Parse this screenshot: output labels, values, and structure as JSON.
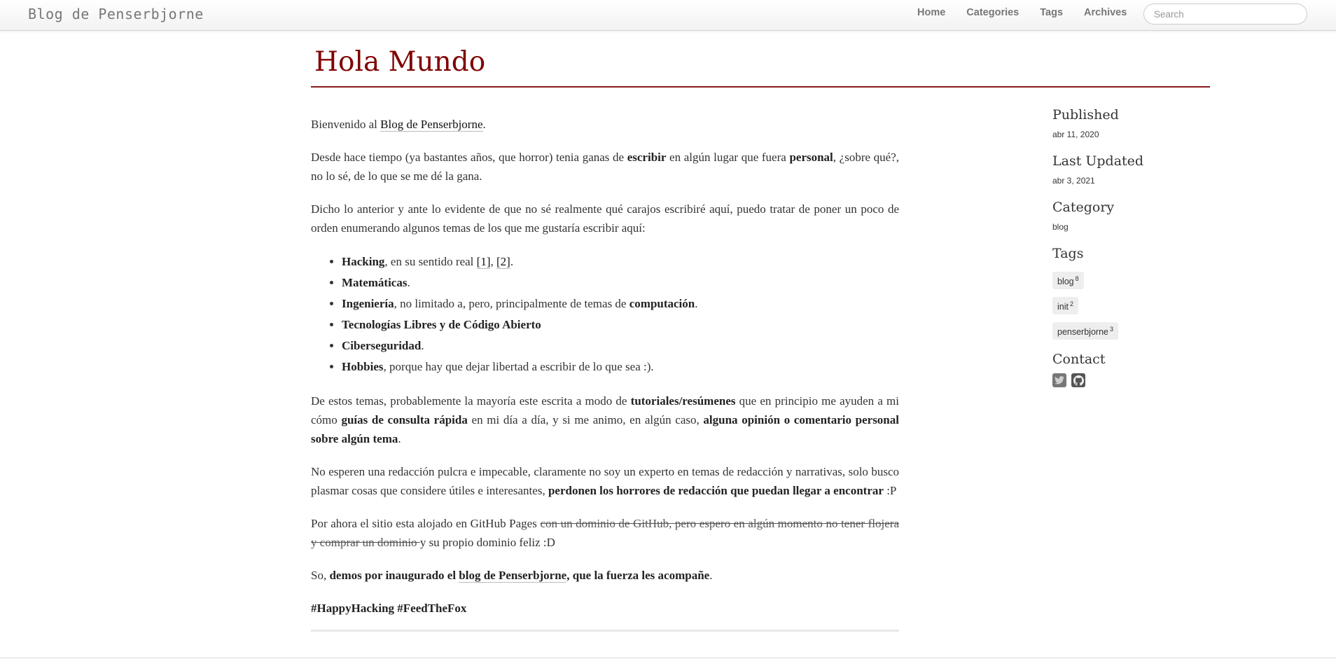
{
  "navbar": {
    "brand": "Blog de Penserbjorne",
    "links": [
      {
        "label": "Home"
      },
      {
        "label": "Categories"
      },
      {
        "label": "Tags"
      },
      {
        "label": "Archives"
      }
    ],
    "search_placeholder": "Search"
  },
  "post": {
    "title": "Hola Mundo",
    "p1": {
      "t1": "Bienvenido al ",
      "link": "Blog de Penserbjorne",
      "t2": "."
    },
    "p2": {
      "t1": "Desde hace tiempo (ya bastantes años, que horror) tenia ganas de ",
      "b1": "escribir",
      "t2": " en algún lugar que fuera ",
      "b2": "personal",
      "t3": ", ¿sobre qué?, no lo sé, de lo que se me dé la gana."
    },
    "p3": "Dicho lo anterior y ante lo evidente de que no sé realmente qué carajos escribiré aquí, puedo tratar de poner un poco de orden enumerando algunos temas de los que me gustaría escribir aquí:",
    "list": {
      "i1_b": "Hacking",
      "i1_t": ", en su sentido real ",
      "i1_ref1": "[1]",
      "i1_sep": ", ",
      "i1_ref2": "[2]",
      "i1_end": ".",
      "i2_b": "Matemáticas",
      "i2_t": ".",
      "i3_b1": "Ingeniería",
      "i3_t": ", no limitado a, pero, principalmente de temas de ",
      "i3_b2": "computación",
      "i3_end": ".",
      "i4_b": "Tecnologías Libres y de Código Abierto",
      "i5_b": "Ciberseguridad",
      "i5_t": ".",
      "i6_b": "Hobbies",
      "i6_t": ", porque hay que dejar libertad a escribir de lo que sea :)."
    },
    "p4": {
      "t1": "De estos temas, probablemente la mayoría este escrita a modo de ",
      "b1": "tutoriales/resúmenes",
      "t2": " que en principio me ayuden a mi cómo ",
      "b2": "guías de consulta rápida",
      "t3": " en mi día a día, y si me animo, en algún caso, ",
      "b3": "alguna opinión o comentario personal sobre algún tema",
      "t4": "."
    },
    "p5": {
      "t1": "No esperen una redacción pulcra e impecable, claramente no soy un experto en temas de redacción y narrativas, solo busco plasmar cosas que considere útiles e interesantes, ",
      "b1": "perdonen los horrores de redacción que puedan llegar a encontrar",
      "t2": " :P"
    },
    "p6": {
      "t1": "Por ahora el sitio esta alojado en GitHub Pages ",
      "strike": "con un dominio de GitHub, pero espero en algún momento no tener flojera y comprar un dominio ",
      "t2": "y su propio dominio feliz :D"
    },
    "p7": {
      "t1": "So, ",
      "b1": "demos por inaugurado el ",
      "link": "blog de Penserbjorne",
      "b2": ", que la fuerza les acompañe",
      "t2": "."
    },
    "p8": "#HappyHacking #FeedTheFox"
  },
  "sidebar": {
    "published_heading": "Published",
    "published_date": "abr 11, 2020",
    "updated_heading": "Last Updated",
    "updated_date": "abr 3, 2021",
    "category_heading": "Category",
    "category": "blog",
    "tags_heading": "Tags",
    "tags": [
      {
        "name": "blog",
        "count": "8"
      },
      {
        "name": "init",
        "count": "2"
      },
      {
        "name": "penserbjorne",
        "count": "3"
      }
    ],
    "contact_heading": "Contact",
    "contact_icons": [
      "twitter-icon",
      "github-icon"
    ]
  }
}
